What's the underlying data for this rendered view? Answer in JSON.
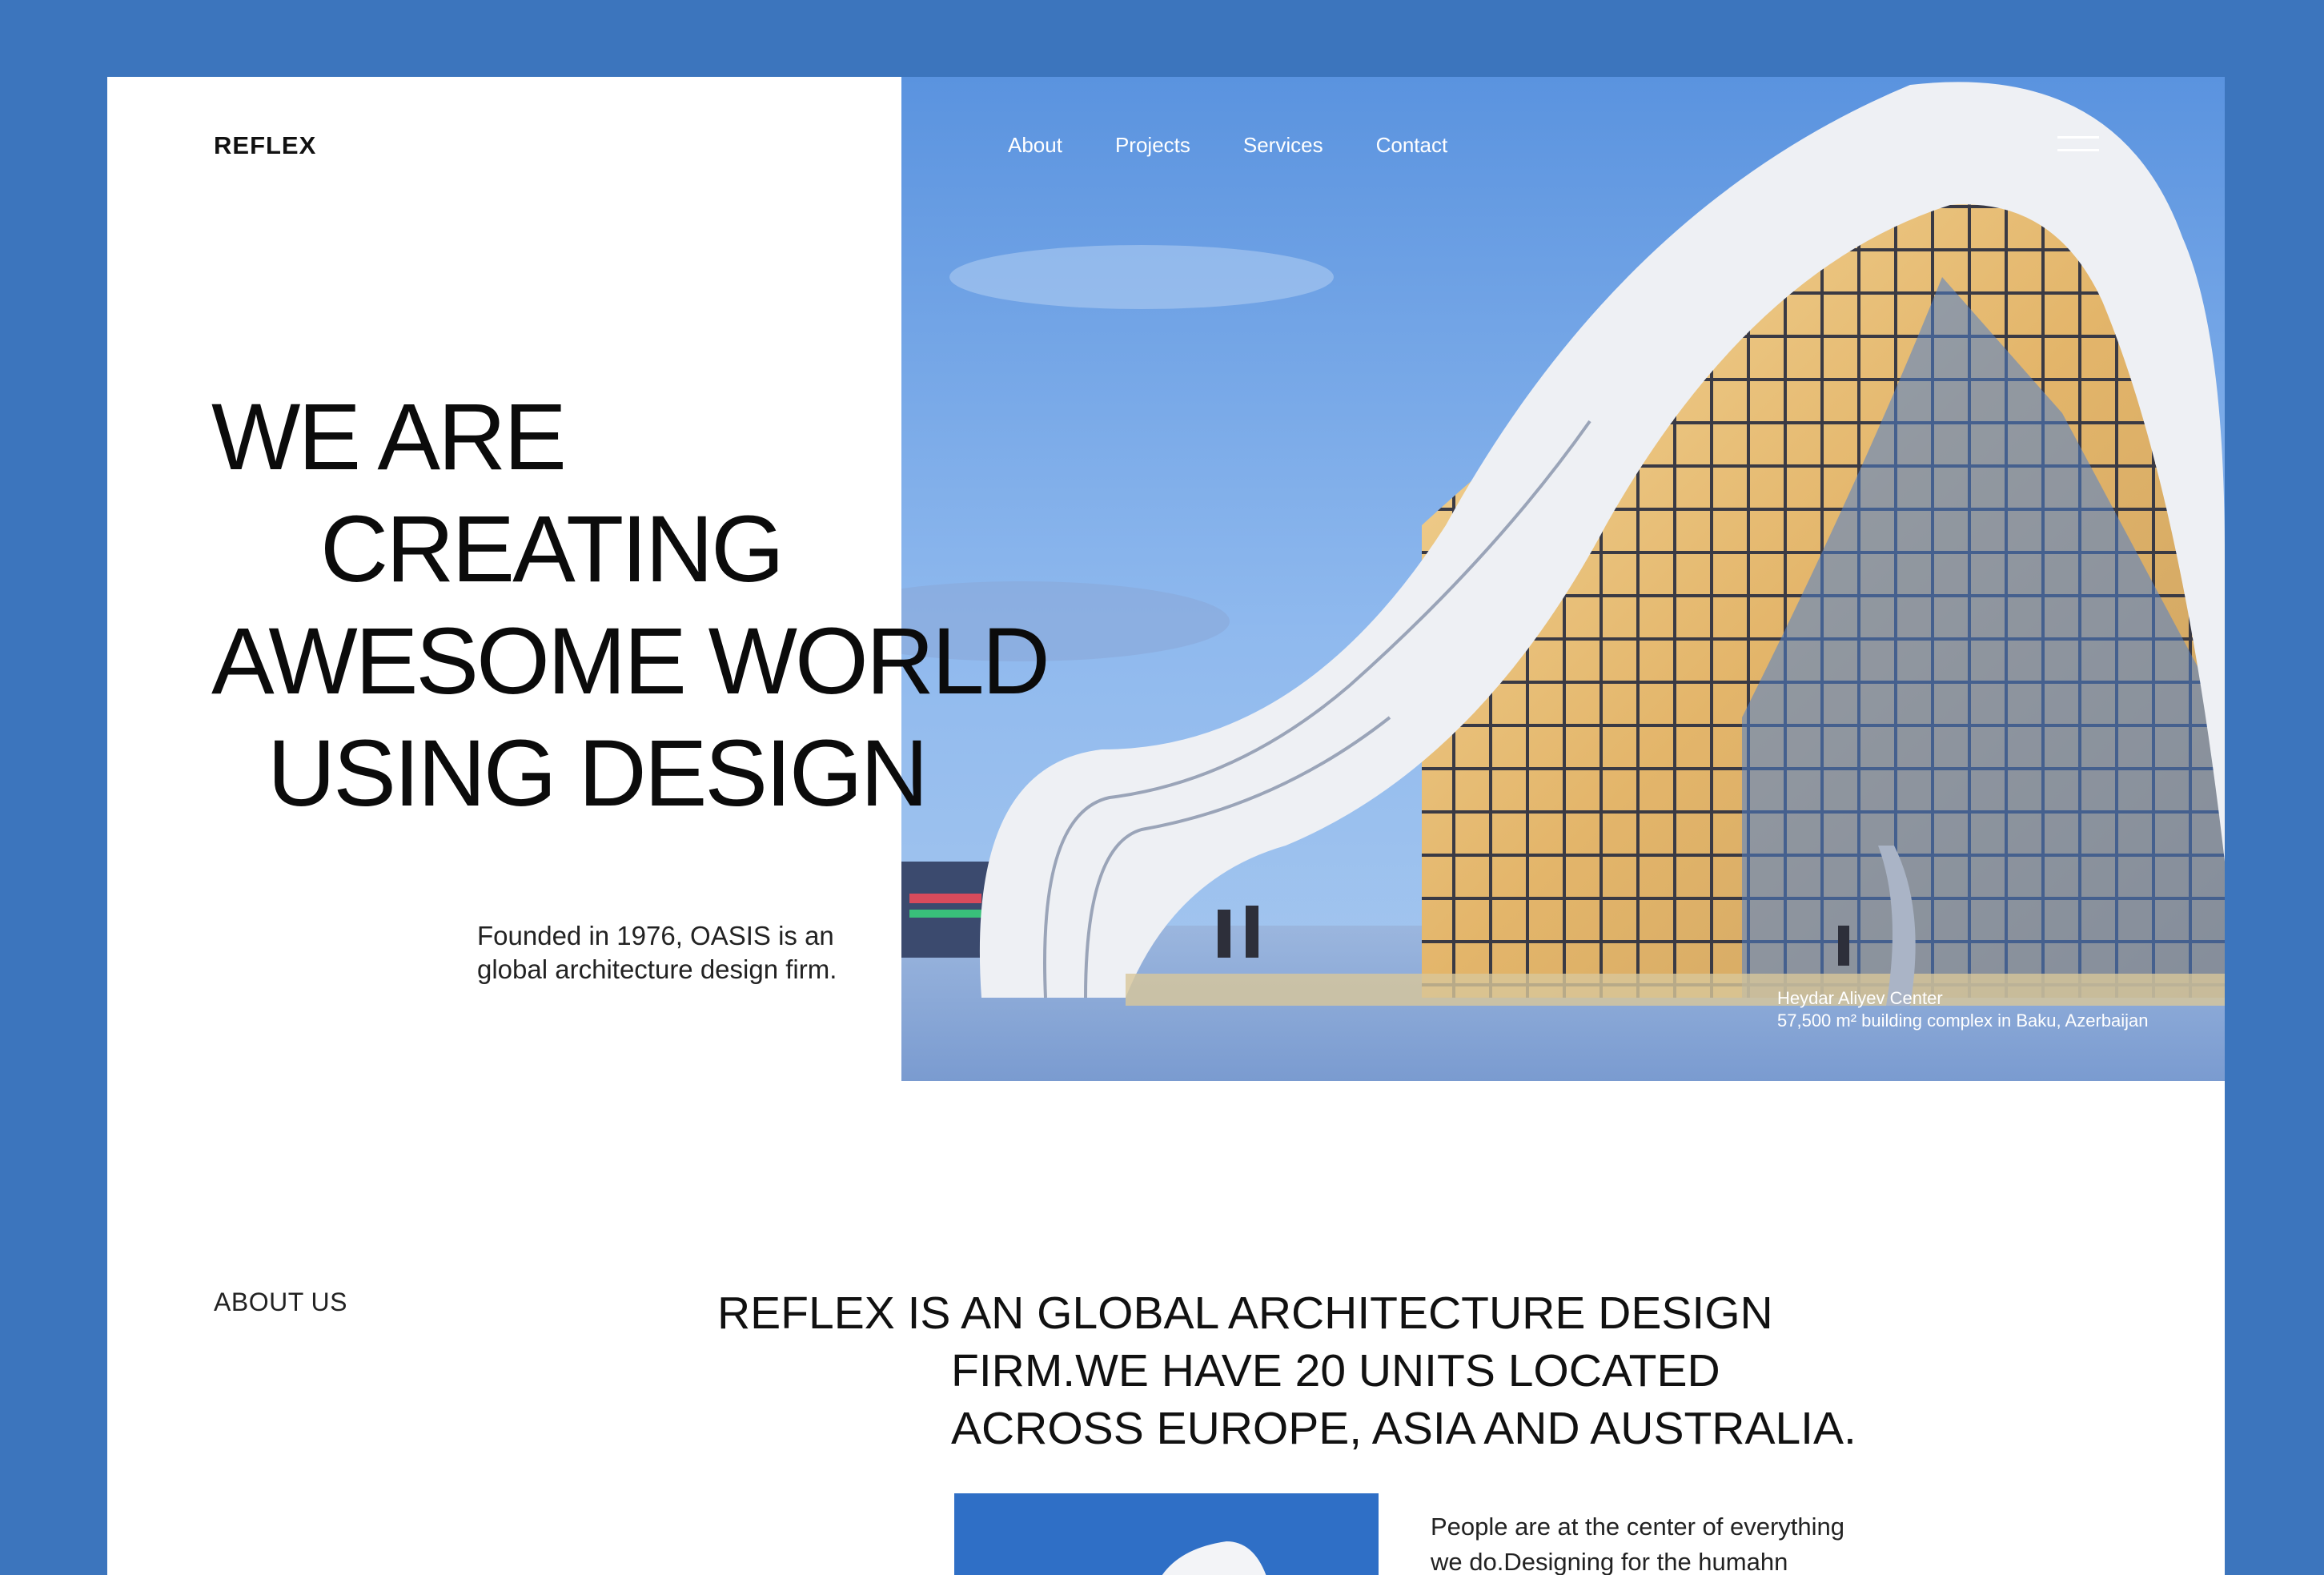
{
  "brand": {
    "logo": "REFLEX"
  },
  "nav": {
    "items": [
      "About",
      "Projects",
      "Services",
      "Contact"
    ],
    "menu_icon": "hamburger-menu-icon"
  },
  "hero": {
    "headline_lines": [
      "WE ARE",
      "CREATING",
      "AWESOME WORLD",
      "USING DESIGN"
    ],
    "founded_text": "Founded in 1976, OASIS is an global architecture design firm.",
    "caption_title": "Heydar Aliyev Center",
    "caption_detail": "57,500 m² building complex in Baku, Azerbaijan"
  },
  "about": {
    "label": "ABOUT US",
    "heading_lines": [
      "REFLEX IS AN GLOBAL ARCHITECTURE DESIGN",
      "FIRM.WE HAVE 20 UNITS LOCATED",
      "ACROSS EUROPE, ASIA AND AUSTRALIA."
    ],
    "body_text": "People are at the center of everything we do.Designing for the humahn experience is our main"
  },
  "colors": {
    "frame": "#3c75bd",
    "page": "#ffffff",
    "text": "#111111",
    "sky": "#6f9fdc"
  }
}
